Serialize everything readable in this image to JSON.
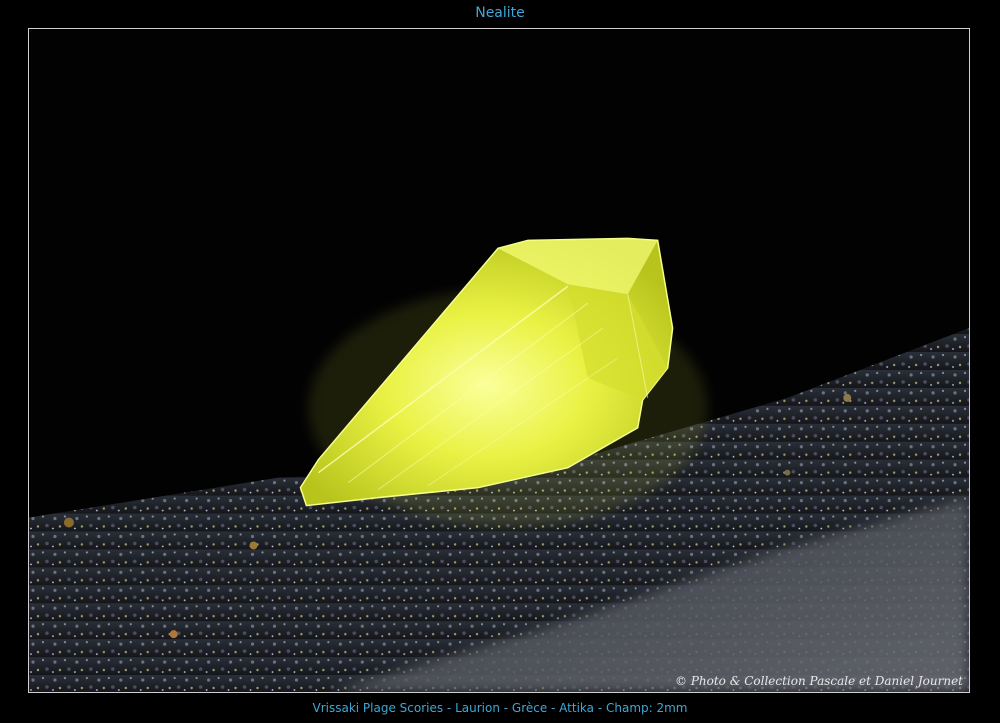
{
  "title": "Nealite",
  "caption": "Vrissaki Plage Scories - Laurion - Grèce - Attika - Champ: 2mm",
  "photo": {
    "watermark": "© Photo & Collection Pascale et Daniel Journet",
    "subject": "yellow-crystal-on-dark-matrix"
  },
  "colors": {
    "title_text": "#3fa7d6",
    "frame_border": "#cfcfcf",
    "crystal": "#e6f03c",
    "matrix": "#1c1f26"
  }
}
